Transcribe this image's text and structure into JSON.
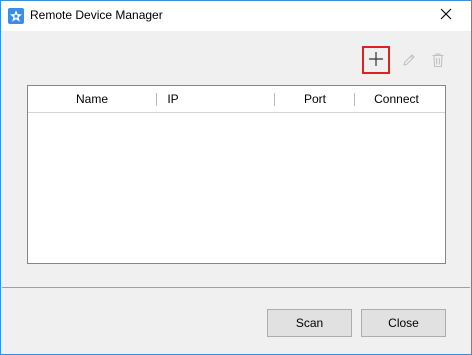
{
  "window": {
    "title": "Remote Device Manager",
    "icons": {
      "app": "app-logo-icon",
      "close": "close-icon"
    }
  },
  "toolbar": {
    "add_icon": "plus-icon",
    "edit_icon": "pencil-icon",
    "delete_icon": "trash-icon",
    "add_highlight_color": "#e02020"
  },
  "table": {
    "columns": [
      "Name",
      "IP",
      "Port",
      "Connect"
    ],
    "rows": []
  },
  "footer": {
    "scan_label": "Scan",
    "close_label": "Close"
  },
  "colors": {
    "window_border": "#3c8fd6",
    "background": "#f0f0f0",
    "icon_blue": "#3a8ee6"
  }
}
